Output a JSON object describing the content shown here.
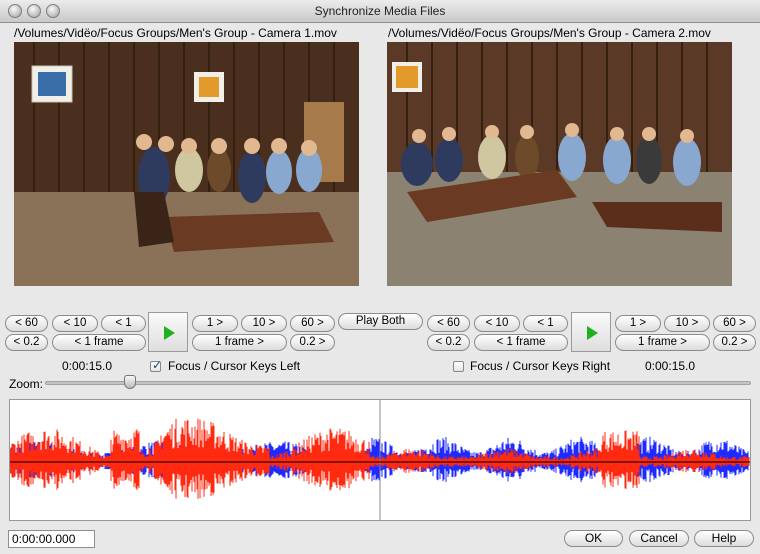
{
  "window": {
    "title": "Synchronize Media Files"
  },
  "left": {
    "file_path": "/Volumes/Vidëo/Focus Groups/Men's Group - Camera 1.mov",
    "buttons": {
      "back60": "< 60",
      "back10": "< 10",
      "back1": "< 1",
      "back02": "< 0.2",
      "back_frame": "< 1 frame",
      "fwd1": "1 >",
      "fwd10": "10 >",
      "fwd60": "60 >",
      "fwd_frame": "1 frame >",
      "fwd02": "0.2 >"
    },
    "time": "0:00:15.0",
    "focus_label": "Focus / Cursor Keys Left",
    "focus_checked": true
  },
  "play_both_label": "Play Both",
  "right": {
    "file_path": "/Volumes/Vidëo/Focus Groups/Men's Group - Camera 2.mov",
    "buttons": {
      "back60": "< 60",
      "back10": "< 10",
      "back1": "< 1",
      "back02": "< 0.2",
      "back_frame": "< 1 frame",
      "fwd1": "1 >",
      "fwd10": "10 >",
      "fwd60": "60 >",
      "fwd_frame": "1 frame >",
      "fwd02": "0.2 >"
    },
    "time": "0:00:15.0",
    "focus_label": "Focus / Cursor Keys Right",
    "focus_checked": false
  },
  "zoom": {
    "label": "Zoom:",
    "level": 0.12
  },
  "waveform": {
    "colors": {
      "left": "#ff2a10",
      "right": "#1e2aff",
      "midline": "#000000",
      "cursor": "#888888"
    }
  },
  "timestamp_value": "0:00:00.000",
  "footer": {
    "ok": "OK",
    "cancel": "Cancel",
    "help": "Help"
  },
  "icons": {
    "play": "play-icon"
  },
  "accent_colors": {
    "play": "#1fb11f"
  }
}
